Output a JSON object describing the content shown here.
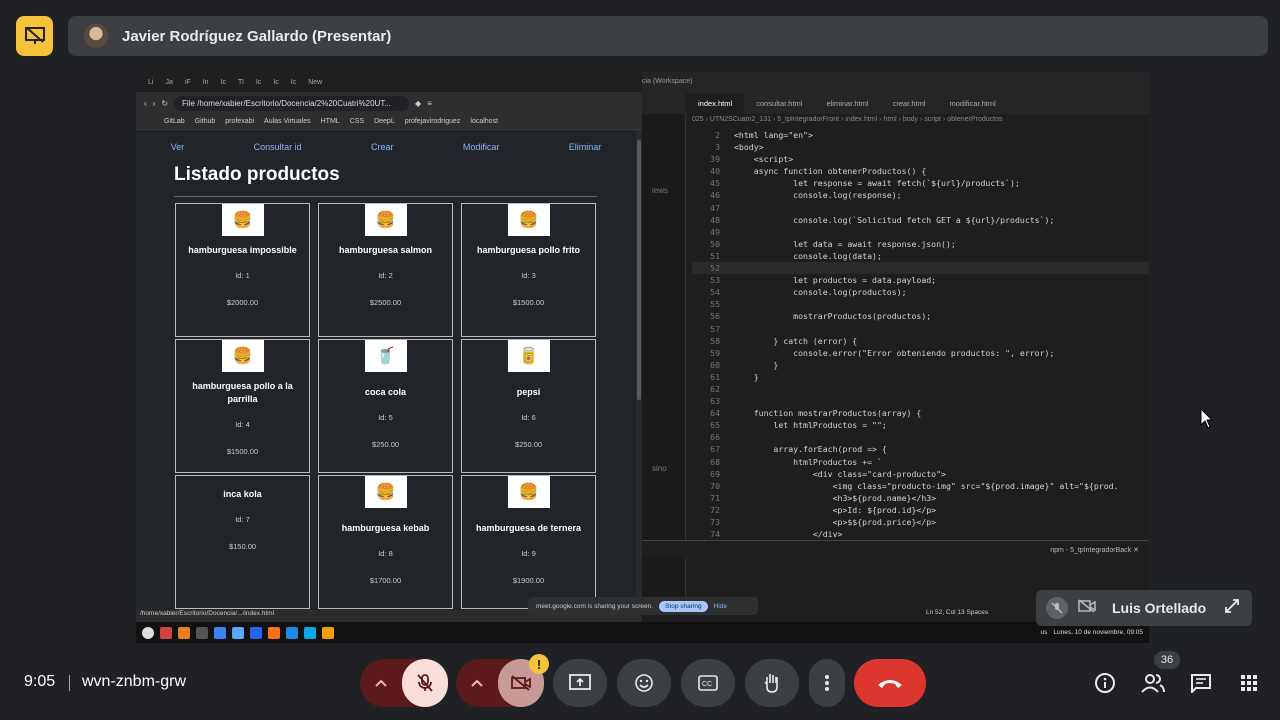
{
  "presenter": {
    "name": "Javier Rodríguez Gallardo (Presentar)"
  },
  "browser": {
    "tabs": [
      "Li",
      "Ja",
      "iF",
      "In",
      "Ic",
      "Tl",
      "Ic",
      "Ic",
      "Ic",
      "New"
    ],
    "url": "File   /home/xabier/Escritorio/Docencia/2%20Cuatri%20UT...",
    "bookmarks": [
      "GitLab",
      "Github",
      "profexabi",
      "Aulas Virtuales",
      "HTML",
      "CSS",
      "DeepL",
      "profejavirodriguez",
      "localhost"
    ],
    "nav": [
      "Ver",
      "Consultar id",
      "Crear",
      "Modificar",
      "Eliminar"
    ],
    "title": "Listado productos",
    "status_url": "/home/xabier/Escritorio/Docencia/.../index.html",
    "products": [
      {
        "name": "hamburguesa impossible",
        "id": "Id: 1",
        "price": "$2000.00",
        "icon": "burger-image"
      },
      {
        "name": "hamburguesa salmon",
        "id": "Id: 2",
        "price": "$2500.00",
        "icon": "burger-image"
      },
      {
        "name": "hamburguesa pollo frito",
        "id": "Id: 3",
        "price": "$1500.00",
        "icon": "burger-image"
      },
      {
        "name": "hamburguesa pollo a la parrilla",
        "id": "Id: 4",
        "price": "$1500.00",
        "icon": "burger-image"
      },
      {
        "name": "coca cola",
        "id": "Id: 5",
        "price": "$250.00",
        "icon": "coca-cola-image"
      },
      {
        "name": "pepsi",
        "id": "Id: 6",
        "price": "$250.00",
        "icon": "pepsi-image"
      },
      {
        "name": "inca kola",
        "id": "Id: 7",
        "price": "$150.00",
        "icon": ""
      },
      {
        "name": "hamburguesa kebab",
        "id": "Id: 8",
        "price": "$1700.00",
        "icon": "burger-image"
      },
      {
        "name": "hamburguesa de ternera",
        "id": "Id: 9",
        "price": "$1900.00",
        "icon": "burger-image"
      }
    ]
  },
  "editor": {
    "window_title": "cia (Workspace)",
    "tabs": [
      "index.html",
      "consultar.html",
      "eliminar.html",
      "crear.html",
      "modificar.html"
    ],
    "breadcrumbs": "025 › UTN2SCuatri2_131 › 5_tpIntegradorFront › index.html › html › body › script › obtenerProductos",
    "side_labels": [
      "iews",
      "sino"
    ],
    "lines": [
      {
        "n": "2",
        "t": "<html lang=\"en\">"
      },
      {
        "n": "3",
        "t": "<body>"
      },
      {
        "n": "39",
        "t": "    <script>"
      },
      {
        "n": "40",
        "t": "    async function obtenerProductos() {"
      },
      {
        "n": "45",
        "t": "            let response = await fetch(`${url}/products`);"
      },
      {
        "n": "46",
        "t": "            console.log(response);"
      },
      {
        "n": "47",
        "t": ""
      },
      {
        "n": "48",
        "t": "            console.log(`Solicitud fetch GET a ${url}/products`);"
      },
      {
        "n": "49",
        "t": ""
      },
      {
        "n": "50",
        "t": "            let data = await response.json();"
      },
      {
        "n": "51",
        "t": "            console.log(data);"
      },
      {
        "n": "52",
        "t": ""
      },
      {
        "n": "53",
        "t": "            let productos = data.payload;"
      },
      {
        "n": "54",
        "t": "            console.log(productos);"
      },
      {
        "n": "55",
        "t": ""
      },
      {
        "n": "56",
        "t": "            mostrarProductos(productos);"
      },
      {
        "n": "57",
        "t": ""
      },
      {
        "n": "58",
        "t": "        } catch (error) {"
      },
      {
        "n": "59",
        "t": "            console.error(\"Error obteniendo productos: \", error);"
      },
      {
        "n": "60",
        "t": "        }"
      },
      {
        "n": "61",
        "t": "    }"
      },
      {
        "n": "62",
        "t": ""
      },
      {
        "n": "63",
        "t": ""
      },
      {
        "n": "64",
        "t": "    function mostrarProductos(array) {"
      },
      {
        "n": "65",
        "t": "        let htmlProductos = \"\";"
      },
      {
        "n": "66",
        "t": ""
      },
      {
        "n": "67",
        "t": "        array.forEach(prod => {"
      },
      {
        "n": "68",
        "t": "            htmlProductos += `"
      },
      {
        "n": "69",
        "t": "                <div class=\"card-producto\">"
      },
      {
        "n": "70",
        "t": "                    <img class=\"producto-img\" src=\"${prod.image}\" alt=\"${prod."
      },
      {
        "n": "71",
        "t": "                    <h3>${prod.name}</h3>"
      },
      {
        "n": "72",
        "t": "                    <p>Id: ${prod.id}</p>"
      },
      {
        "n": "73",
        "t": "                    <p>$${prod.price}</p>"
      },
      {
        "n": "74",
        "t": "                </div>"
      }
    ],
    "terminal_label": "npm - 5_tpIntegradorBack",
    "status": "Ln 52, Col 13   Spaces"
  },
  "share_notice": {
    "text": "meet.google.com is sharing your screen.",
    "stop": "Stop sharing",
    "hide": "Hide"
  },
  "taskbar": {
    "clock": "Lunes, 10 de noviembre, 09:05",
    "lang": "us"
  },
  "participant": {
    "name": "Luis Ortellado"
  },
  "meeting": {
    "time": "9:05",
    "code": "wvn-znbm-grw",
    "participant_count": "36",
    "warning": "!"
  }
}
